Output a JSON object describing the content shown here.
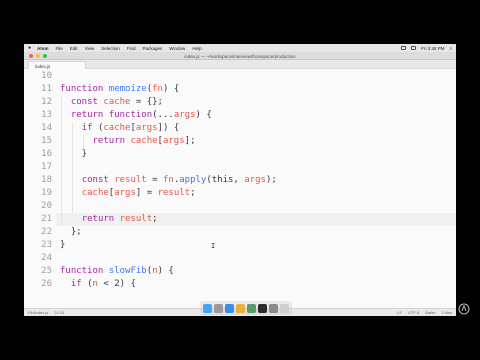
{
  "menubar": {
    "items": [
      "Atom",
      "File",
      "Edit",
      "View",
      "Selection",
      "Find",
      "Packages",
      "Window",
      "Help"
    ],
    "clock": "Fri 2:48 PM"
  },
  "window": {
    "title": "index.js — ~/workspace/interview/fromspace/production"
  },
  "tab": {
    "label": "index.js"
  },
  "editor": {
    "line_numbers": [
      "10",
      "11",
      "12",
      "13",
      "14",
      "15",
      "16",
      "17",
      "18",
      "19",
      "20",
      "21",
      "22",
      "23",
      "24",
      "25",
      "26"
    ],
    "lines": [
      "",
      "function memoize(fn) {",
      "  const cache = {};",
      "  return function(...args) {",
      "    if (cache[args]) {",
      "      return cache[args];",
      "    }",
      "",
      "    const result = fn.apply(this, args);",
      "    cache[args] = result;",
      "",
      "    return result;",
      "  };",
      "}",
      "",
      "function slowFib(n) {",
      "  if (n < 2) {"
    ],
    "active_line": "21"
  },
  "statusbar": {
    "file": "Fib/index.js",
    "position": "21:20",
    "line_ending": "LF",
    "encoding": "UTF-8",
    "grammar": "Babel",
    "files": "3 files"
  },
  "colors": {
    "keyword": "#a626a4",
    "function": "#4078f2",
    "variable": "#e45649",
    "text": "#383a42",
    "line_number": "#9d9d9f"
  }
}
